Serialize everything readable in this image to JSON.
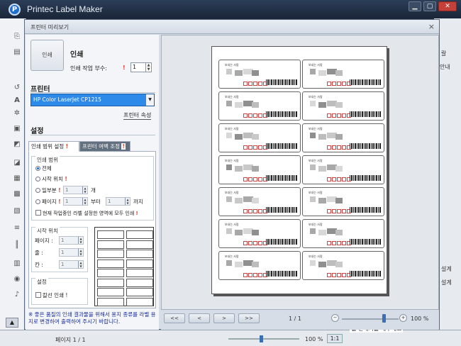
{
  "app": {
    "title": "Printec Label Maker",
    "logo_letter": "P",
    "min": "▁",
    "max": "▢",
    "close": "✕"
  },
  "dialog": {
    "title": "프린터 미리보기",
    "close": "×"
  },
  "print": {
    "button_label": "인쇄",
    "section_title": "인쇄",
    "copies_label": "인쇄 작업 부수:",
    "copies_value": "1",
    "mark": "!"
  },
  "printer": {
    "section_title": "프린터",
    "selected": "HP Color LaserJet CP1215",
    "properties_label": "프린터 속성"
  },
  "settings": {
    "section_title": "설정",
    "tabs": [
      {
        "label": "인쇄 범위 설정",
        "mark": "!"
      },
      {
        "label": "프린터 여백 조정",
        "mark": "!"
      }
    ],
    "range_group": "인쇄 범위",
    "opt_all": "전체",
    "opt_start": "시작 위치",
    "opt_part": "일부분",
    "opt_part_unit": "개",
    "opt_page": "페이지",
    "opt_from": "부터",
    "opt_to": "까지",
    "opt_current": "현재 작업중인 라벨 설정한 영역에 모두 인쇄",
    "spin_value": "1",
    "start_group": "시작 위치",
    "start_page": "페이지 :",
    "start_row": "줄 :",
    "start_col": "칸 :",
    "set_group": "설정",
    "outline_print": "칼선 인쇄 !"
  },
  "note": "※ 좋은 품질의 인쇄 결과물을 위해서 용지 종류를 라벨 용지로 변경하여 출력하여 주시기 바랍니다.",
  "preview": {
    "label_text": "보내는 사람",
    "nav": [
      "<<",
      "<",
      ">",
      ">>"
    ],
    "page_info": "1 / 1",
    "zoom_minus": "−",
    "zoom_plus": "+",
    "zoom_value": "100 %",
    "zoom_percent": 100
  },
  "background": {
    "page_label": "페이지 1 / 1",
    "zoom": "100 %",
    "one": "1:1",
    "tooltip": "펠 편내기를 해주세요",
    "right_labels": [
      "랄",
      "안내",
      "설계",
      "설계"
    ],
    "blank_btn": "▲"
  }
}
